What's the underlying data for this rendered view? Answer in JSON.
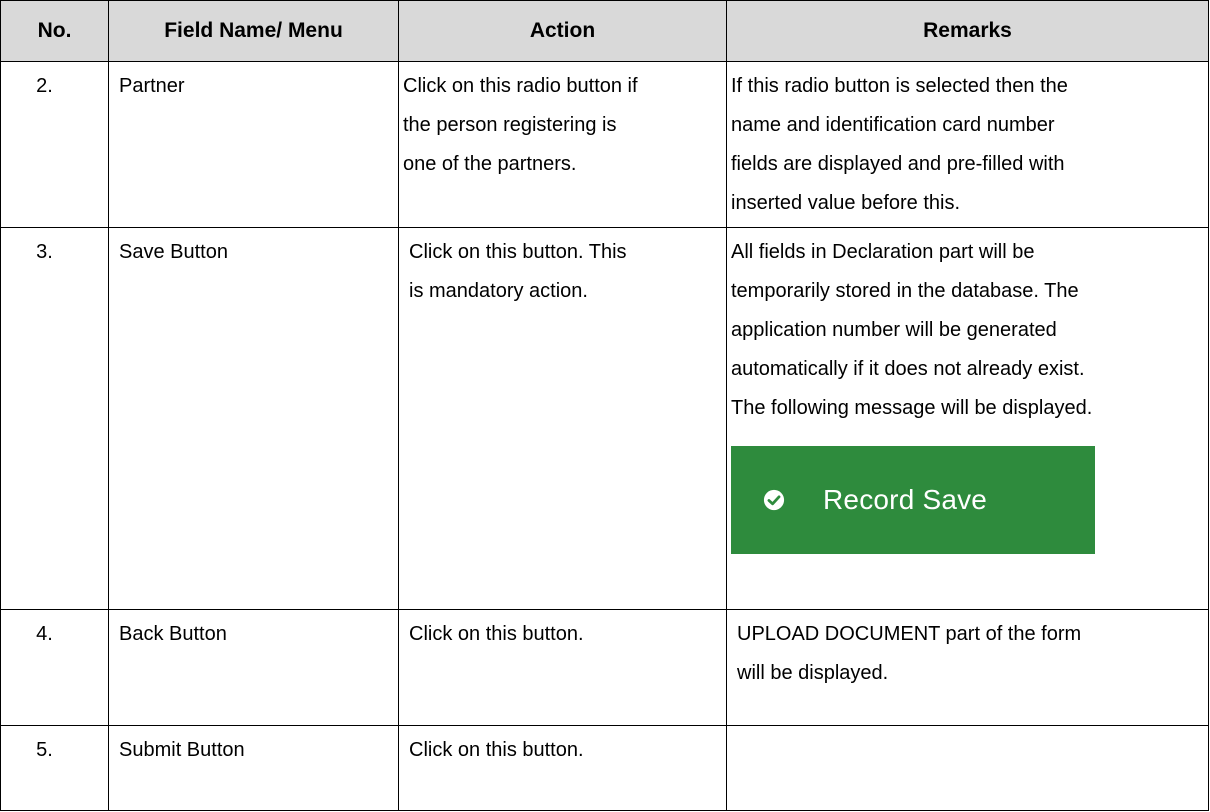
{
  "header": {
    "no": "No.",
    "field": "Field Name/ Menu",
    "action": "Action",
    "remarks": "Remarks"
  },
  "rows": [
    {
      "no": "2.",
      "field": "Partner",
      "action": [
        "Click on this radio button if",
        "the person registering is",
        "one of the partners."
      ],
      "remarks": [
        "If this radio button is selected then the",
        "name and identification card number",
        "fields are displayed and pre-filled with",
        "inserted value before this."
      ]
    },
    {
      "no": "3.",
      "field": "Save Button",
      "action": [
        "Click on this button. This",
        "is mandatory action."
      ],
      "remarks": [
        "All fields in Declaration part will be",
        "temporarily stored in the database. The",
        "application number will be generated",
        "automatically if it does not already exist.",
        "The following message will be displayed."
      ],
      "toast": {
        "text": "Record Save",
        "icon": "check-circle-icon",
        "color": "#2e8b3d"
      }
    },
    {
      "no": "4.",
      "field": "Back Button",
      "action": [
        "Click on this button."
      ],
      "remarks": [
        "UPLOAD DOCUMENT part of the form",
        "will be displayed."
      ]
    },
    {
      "no": "5.",
      "field": "Submit Button",
      "action": [
        "Click on this button."
      ],
      "remarks": []
    }
  ]
}
